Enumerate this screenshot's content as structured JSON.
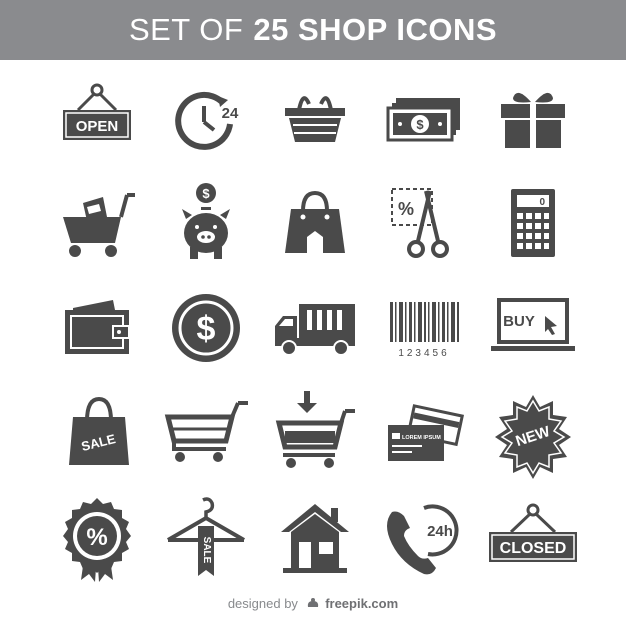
{
  "title": {
    "light": "SET OF",
    "bold": "25 SHOP ICONS"
  },
  "icon_color": "#4a4a4a",
  "banner_color": "#8a8b8e",
  "icons": [
    {
      "name": "open-sign-icon",
      "text": "OPEN"
    },
    {
      "name": "clock-24-icon",
      "text": "24"
    },
    {
      "name": "shopping-basket-icon"
    },
    {
      "name": "banknotes-icon",
      "text": "$"
    },
    {
      "name": "gift-box-icon"
    },
    {
      "name": "shopping-cart-full-icon"
    },
    {
      "name": "piggy-bank-icon",
      "text": "$"
    },
    {
      "name": "shopping-bag-icon"
    },
    {
      "name": "discount-coupon-scissors-icon",
      "text": "%"
    },
    {
      "name": "calculator-icon",
      "text": "0"
    },
    {
      "name": "wallet-icon"
    },
    {
      "name": "dollar-coin-icon",
      "text": "$"
    },
    {
      "name": "delivery-truck-icon"
    },
    {
      "name": "barcode-icon",
      "text": "123456"
    },
    {
      "name": "buy-laptop-icon",
      "text": "BUY"
    },
    {
      "name": "sale-bag-icon",
      "text": "SALE"
    },
    {
      "name": "empty-cart-icon"
    },
    {
      "name": "add-to-cart-icon"
    },
    {
      "name": "credit-cards-icon",
      "text": "LOREM IPSUM"
    },
    {
      "name": "new-badge-icon",
      "text": "NEW"
    },
    {
      "name": "percent-badge-icon",
      "text": "%"
    },
    {
      "name": "hanger-sale-icon",
      "text": "SALE"
    },
    {
      "name": "store-house-icon"
    },
    {
      "name": "phone-24h-icon",
      "text": "24h"
    },
    {
      "name": "closed-sign-icon",
      "text": "CLOSED"
    }
  ],
  "credit": {
    "prefix": "designed by",
    "brand": "freepik.com"
  }
}
